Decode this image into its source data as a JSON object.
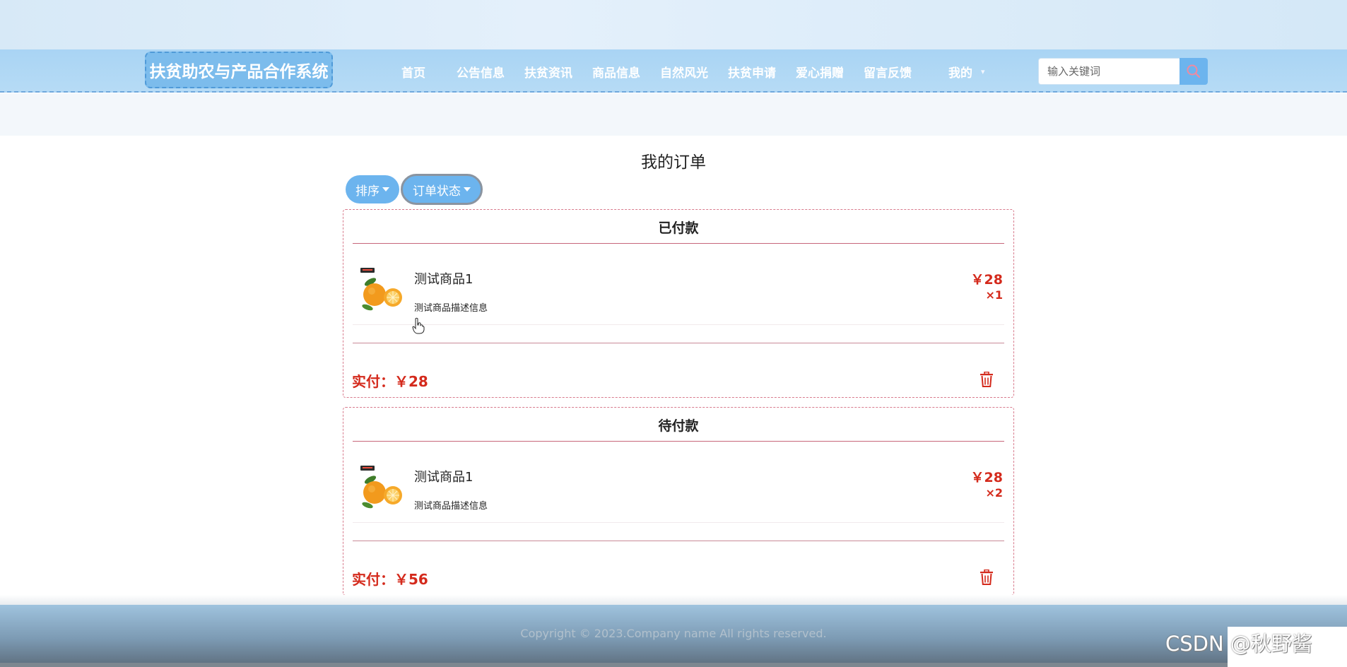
{
  "header": {
    "site_title": "扶贫助农与产品合作系统",
    "nav": [
      {
        "label": "首页"
      },
      {
        "label": "公告信息"
      },
      {
        "label": "扶贫资讯"
      },
      {
        "label": "商品信息"
      },
      {
        "label": "自然风光"
      },
      {
        "label": "扶贫申请"
      },
      {
        "label": "爱心捐赠"
      },
      {
        "label": "留言反馈"
      },
      {
        "label": "我的"
      }
    ],
    "search": {
      "placeholder": "输入关键词",
      "icon": "search-icon"
    }
  },
  "main": {
    "page_title": "我的订单",
    "filters": {
      "sort_label": "排序",
      "status_label": "订单状态"
    },
    "orders": [
      {
        "status": "已付款",
        "item_name": "测试商品1",
        "item_desc": "测试商品描述信息",
        "price": "￥28",
        "quantity": "×1",
        "paid_label": "实付：",
        "paid_amount": "￥28",
        "delete_icon": "trash-icon"
      },
      {
        "status": "待付款",
        "item_name": "测试商品1",
        "item_desc": "测试商品描述信息",
        "price": "￥28",
        "quantity": "×2",
        "paid_label": "实付：",
        "paid_amount": "￥56",
        "delete_icon": "trash-icon"
      }
    ]
  },
  "footer": {
    "copyright": "Copyright © 2023.Company name All rights reserved."
  },
  "watermark": "CSDN @秋野酱",
  "colors": {
    "accent": "#6cb4ee",
    "price_red": "#d42a1c",
    "divider": "#c7667a",
    "nav_bg": "#a9d4f4"
  }
}
